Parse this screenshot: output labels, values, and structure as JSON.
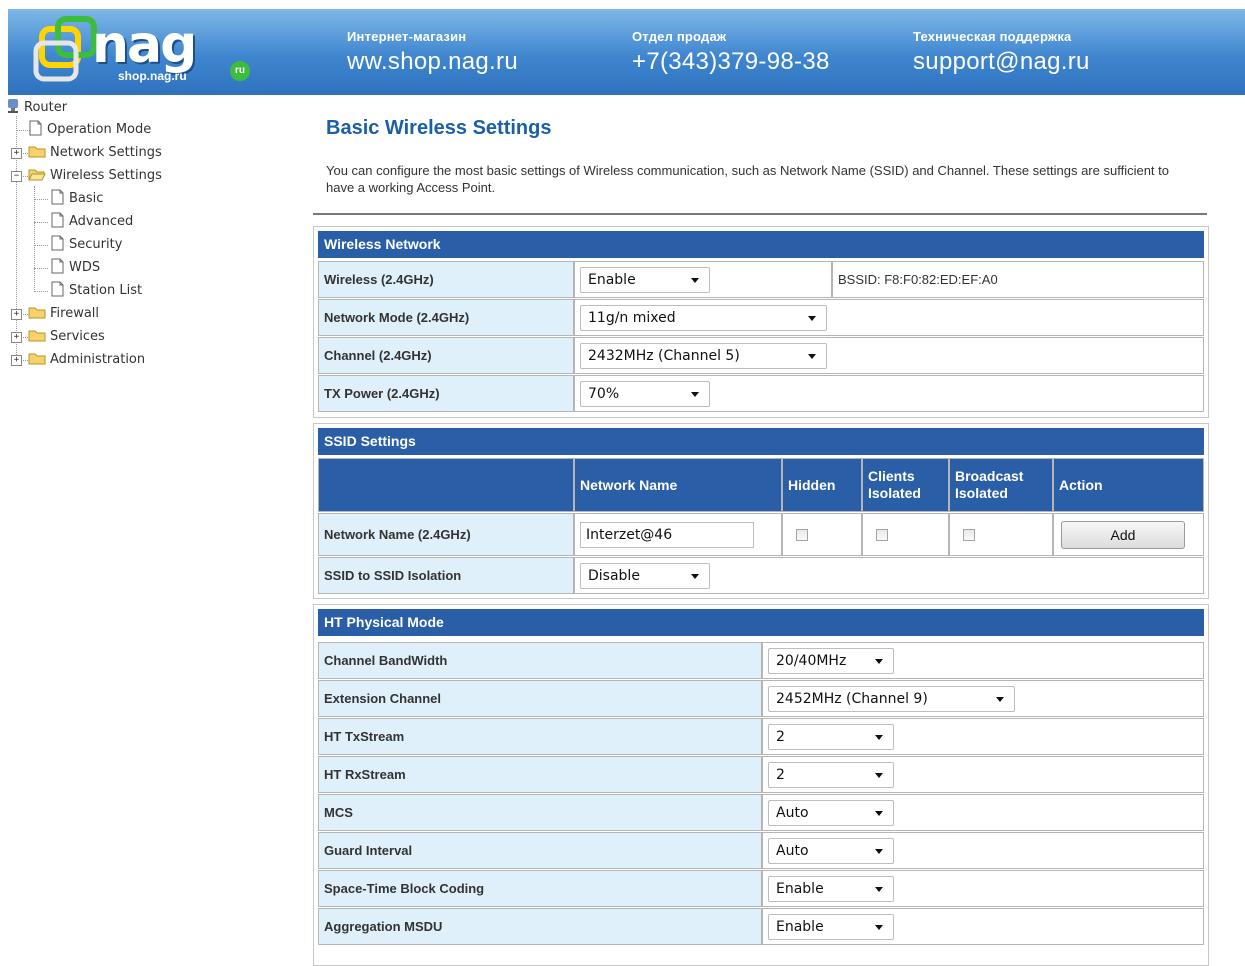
{
  "banner": {
    "logo_text": "nag",
    "logo_sub": "shop.nag.ru",
    "logo_badge": "ru",
    "shop_caption": "Интернет-магазин",
    "shop_value": "ww.shop.nag.ru",
    "sales_caption": "Отдел продаж",
    "sales_value": "+7(343)379-98-38",
    "support_caption": "Техническая поддержка",
    "support_value": "support@nag.ru"
  },
  "tree": {
    "root": "Router",
    "items": [
      "Operation Mode",
      "Network Settings",
      "Wireless Settings",
      "Basic",
      "Advanced",
      "Security",
      "WDS",
      "Station List",
      "Firewall",
      "Services",
      "Administration"
    ]
  },
  "page": {
    "title": "Basic Wireless Settings",
    "description": "You can configure the most basic settings of Wireless communication, such as Network Name (SSID) and Channel. These settings are sufficient to have a working Access Point."
  },
  "wireless_network": {
    "header": "Wireless Network",
    "wireless_label": "Wireless (2.4GHz)",
    "wireless_value": "Enable",
    "bssid": "BSSID: F8:F0:82:ED:EF:A0",
    "mode_label": "Network Mode (2.4GHz)",
    "mode_value": "11g/n mixed",
    "channel_label": "Channel (2.4GHz)",
    "channel_value": "2432MHz (Channel 5)",
    "txpower_label": "TX Power (2.4GHz)",
    "txpower_value": "70%"
  },
  "ssid": {
    "header": "SSID Settings",
    "col_name": "Network Name",
    "col_hidden": "Hidden",
    "col_clients_isolated": "Clients Isolated",
    "col_broadcast_isolated": "Broadcast Isolated",
    "col_action": "Action",
    "name_label": "Network Name (2.4GHz)",
    "name_value": "Interzet@46",
    "add_label": "Add",
    "isolation_label": "SSID to SSID Isolation",
    "isolation_value": "Disable"
  },
  "ht": {
    "header": "HT Physical Mode",
    "rows": [
      {
        "label": "Channel BandWidth",
        "value": "20/40MHz"
      },
      {
        "label": "Extension Channel",
        "value": "2452MHz (Channel 9)"
      },
      {
        "label": "HT TxStream",
        "value": "2"
      },
      {
        "label": "HT RxStream",
        "value": "2"
      },
      {
        "label": "MCS",
        "value": "Auto"
      },
      {
        "label": "Guard Interval",
        "value": "Auto"
      },
      {
        "label": "Space-Time Block Coding",
        "value": "Enable"
      },
      {
        "label": "Aggregation MSDU",
        "value": "Enable"
      }
    ]
  },
  "colors": {
    "banner_blue": "#3f86cf",
    "section_header": "#2a5fa8",
    "label_cell": "#dff0fb",
    "title_blue": "#1a5fa8"
  }
}
